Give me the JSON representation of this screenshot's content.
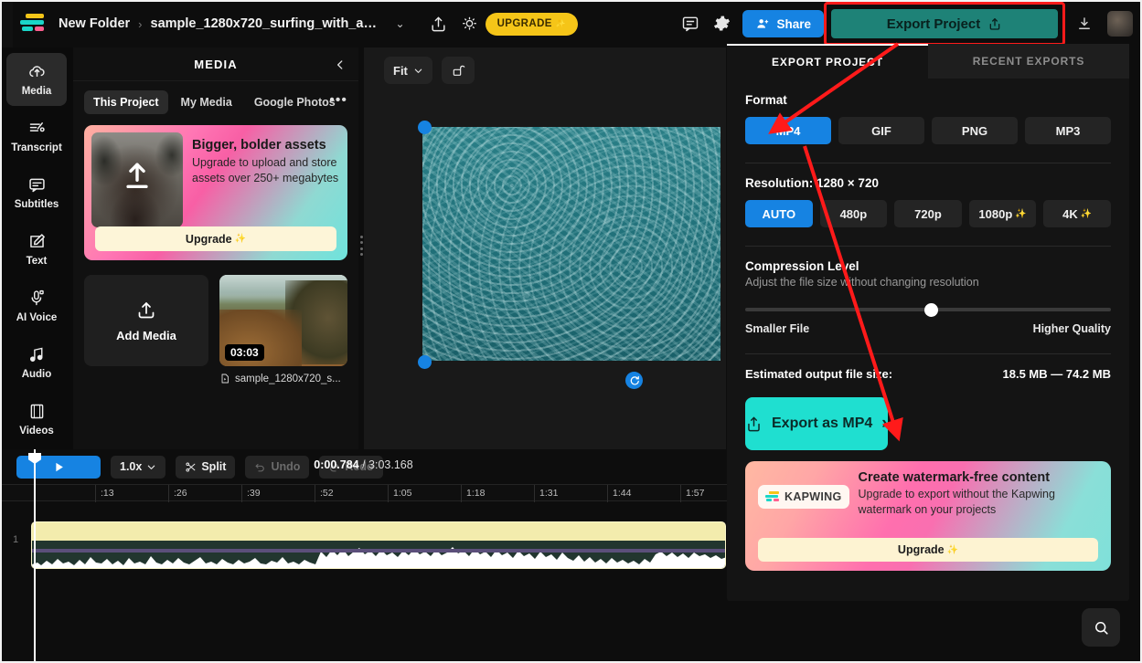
{
  "topbar": {
    "folder": "New Folder",
    "separator": "›",
    "project_name": "sample_1280x720_surfing_with_au...",
    "caret": "⌄",
    "upgrade_label": "UPGRADE",
    "upgrade_sparkle": "✨",
    "share_label": "Share",
    "export_project_label": "Export Project",
    "icons": {
      "share_out": "share-icon",
      "idea": "lightbulb-icon",
      "comment": "comment-icon",
      "settings": "gear-icon",
      "download": "download-icon"
    },
    "highlight_color": "#ff1a1a",
    "export_btn_color": "#1e8277",
    "share_btn_color": "#1683e2"
  },
  "rail": {
    "items": [
      {
        "label": "Media",
        "icon": "cloud-upload-icon",
        "active": true
      },
      {
        "label": "Transcript",
        "icon": "transcript-icon",
        "active": false
      },
      {
        "label": "Subtitles",
        "icon": "subtitles-icon",
        "active": false
      },
      {
        "label": "Text",
        "icon": "text-edit-icon",
        "active": false
      },
      {
        "label": "AI Voice",
        "icon": "microphone-icon",
        "active": false
      },
      {
        "label": "Audio",
        "icon": "music-note-icon",
        "active": false
      },
      {
        "label": "Videos",
        "icon": "film-strip-icon",
        "active": false
      }
    ]
  },
  "media_panel": {
    "title": "MEDIA",
    "collapse_icon": "chevron-left-icon",
    "overflow_icon": "more-horizontal-icon",
    "tabs": [
      {
        "label": "This Project",
        "active": true
      },
      {
        "label": "My Media",
        "active": false
      },
      {
        "label": "Google Photos",
        "active": false
      }
    ],
    "promo": {
      "title": "Bigger, bolder assets",
      "subtitle": "Upgrade to upload and store assets over 250+ megabytes",
      "button": "Upgrade",
      "button_sparkle": "✨"
    },
    "add_media_label": "Add Media",
    "asset": {
      "duration": "03:03",
      "name": "sample_1280x720_s...",
      "file_icon": "file-video-icon"
    }
  },
  "preview": {
    "fit_label": "Fit",
    "fit_caret": "⌄",
    "lock_icon": "unlock-icon",
    "rotate_icon": "rotate-icon"
  },
  "export_panel": {
    "tabs": [
      {
        "label": "EXPORT PROJECT",
        "active": true
      },
      {
        "label": "RECENT EXPORTS",
        "active": false
      }
    ],
    "format": {
      "label": "Format",
      "options": [
        {
          "label": "MP4",
          "selected": true
        },
        {
          "label": "GIF",
          "selected": false
        },
        {
          "label": "PNG",
          "selected": false
        },
        {
          "label": "MP3",
          "selected": false
        }
      ]
    },
    "resolution": {
      "label": "Resolution:",
      "value": "1280 × 720",
      "options": [
        {
          "label": "AUTO",
          "selected": true,
          "sparkle": ""
        },
        {
          "label": "480p",
          "selected": false,
          "sparkle": ""
        },
        {
          "label": "720p",
          "selected": false,
          "sparkle": ""
        },
        {
          "label": "1080p",
          "selected": false,
          "sparkle": "✨"
        },
        {
          "label": "4K",
          "selected": false,
          "sparkle": "✨"
        }
      ]
    },
    "compression": {
      "label": "Compression Level",
      "sublabel": "Adjust the file size without changing resolution",
      "left_label": "Smaller File",
      "right_label": "Higher Quality",
      "value_percent": 50
    },
    "estimate": {
      "label": "Estimated output file size:",
      "value": "18.5 MB — 74.2 MB"
    },
    "cta": {
      "label": "Export as MP4",
      "chevron": "›",
      "icon": "share-export-icon",
      "color": "#1fdfd0"
    },
    "watermark_card": {
      "brand": "KAPWING",
      "title": "Create watermark-free content",
      "subtitle": "Upgrade to export without the Kapwing watermark on your projects",
      "button": "Upgrade",
      "button_sparkle": "✨"
    }
  },
  "timeline": {
    "play_icon": "play-icon",
    "speed": "1.0x",
    "speed_caret": "⌄",
    "split_label": "Split",
    "split_icon": "scissors-icon",
    "undo_label": "Undo",
    "undo_icon": "undo-icon",
    "redo_label": "Redo",
    "redo_icon": "redo-icon",
    "current_time": "0:00.784",
    "time_sep": " / ",
    "total_time": "3:03.168",
    "ruler_ticks": [
      ":13",
      ":26",
      ":39",
      ":52",
      "1:05",
      "1:18",
      "1:31",
      "1:44",
      "1:57"
    ],
    "track_number": "1"
  },
  "search_fab": {
    "icon": "search-icon"
  }
}
